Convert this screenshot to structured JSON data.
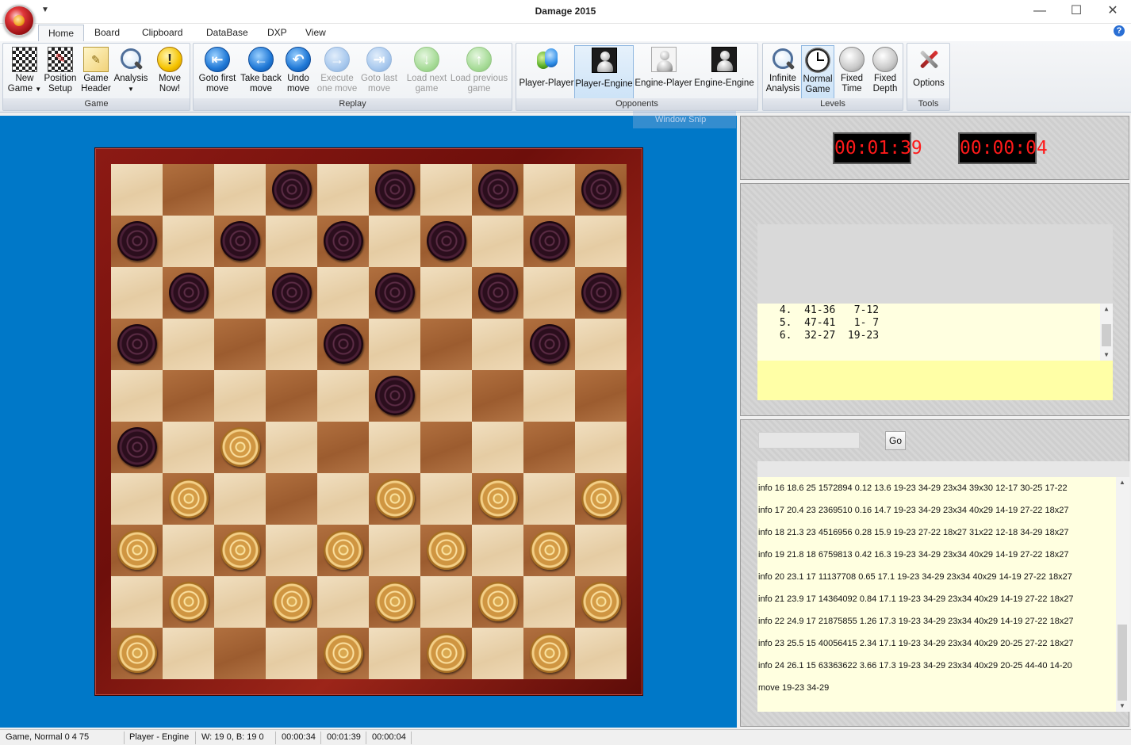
{
  "window": {
    "title": "Damage 2015",
    "minimize_glyph": "—",
    "maximize_glyph": "☐",
    "close_glyph": "✕"
  },
  "ribbon_tabs": [
    {
      "label": "Home",
      "active": true
    },
    {
      "label": "Board",
      "active": false
    },
    {
      "label": "Clipboard",
      "active": false
    },
    {
      "label": "DataBase",
      "active": false
    },
    {
      "label": "DXP",
      "active": false
    },
    {
      "label": "View",
      "active": false
    }
  ],
  "groups": {
    "game": {
      "caption": "Game",
      "new_game": {
        "line1": "New",
        "line2": "Game",
        "icon": "checkerboard-icon"
      },
      "position_setup": {
        "line1": "Position",
        "line2": "Setup",
        "icon": "checkerboard-pencil-icon"
      },
      "game_header": {
        "line1": "Game",
        "line2": "Header",
        "icon": "notepad-icon"
      },
      "analysis": {
        "line1": "Analysis",
        "line2": "",
        "icon": "magnifier-icon"
      },
      "move_now": {
        "line1": "Move",
        "line2": "Now!",
        "icon": "exclamation-icon"
      }
    },
    "replay": {
      "caption": "Replay",
      "goto_first": {
        "line1": "Goto first",
        "line2": "move",
        "icon": "goto-first-icon"
      },
      "take_back": {
        "line1": "Take back",
        "line2": "move",
        "icon": "arrow-left-icon"
      },
      "undo": {
        "line1": "Undo",
        "line2": "move",
        "icon": "undo-icon"
      },
      "execute": {
        "line1": "Execute",
        "line2": "one move",
        "icon": "arrow-right-icon"
      },
      "goto_last": {
        "line1": "Goto last",
        "line2": "move",
        "icon": "goto-last-icon"
      },
      "load_next": {
        "line1": "Load next",
        "line2": "game",
        "icon": "arrow-down-icon"
      },
      "load_previous": {
        "line1": "Load previous",
        "line2": "game",
        "icon": "arrow-up-icon"
      }
    },
    "opponents": {
      "caption": "Opponents",
      "player_player": "Player-Player",
      "player_engine": "Player-Engine",
      "engine_player": "Engine-Player",
      "engine_engine": "Engine-Engine"
    },
    "levels": {
      "caption": "Levels",
      "infinite": {
        "line1": "Infinite",
        "line2": "Analysis"
      },
      "normal": {
        "line1": "Normal",
        "line2": "Game"
      },
      "fixed_time": {
        "line1": "Fixed",
        "line2": "Time"
      },
      "fixed_depth": {
        "line1": "Fixed",
        "line2": "Depth"
      }
    },
    "tools": {
      "caption": "Tools",
      "options": "Options"
    }
  },
  "help_glyph": "?",
  "board": {
    "size": 10,
    "black": [
      [
        0,
        3
      ],
      [
        0,
        5
      ],
      [
        0,
        7
      ],
      [
        0,
        9
      ],
      [
        1,
        0
      ],
      [
        1,
        2
      ],
      [
        1,
        4
      ],
      [
        1,
        6
      ],
      [
        1,
        8
      ],
      [
        2,
        1
      ],
      [
        2,
        3
      ],
      [
        2,
        5
      ],
      [
        2,
        7
      ],
      [
        2,
        9
      ],
      [
        3,
        0
      ],
      [
        3,
        4
      ],
      [
        3,
        8
      ],
      [
        4,
        5
      ],
      [
        5,
        0
      ]
    ],
    "white": [
      [
        5,
        2
      ],
      [
        6,
        1
      ],
      [
        6,
        5
      ],
      [
        6,
        7
      ],
      [
        6,
        9
      ],
      [
        7,
        0
      ],
      [
        7,
        2
      ],
      [
        7,
        4
      ],
      [
        7,
        6
      ],
      [
        7,
        8
      ],
      [
        8,
        1
      ],
      [
        8,
        3
      ],
      [
        8,
        5
      ],
      [
        8,
        7
      ],
      [
        8,
        9
      ],
      [
        9,
        0
      ],
      [
        9,
        4
      ],
      [
        9,
        6
      ],
      [
        9,
        8
      ]
    ]
  },
  "window_snip": "Window Snip",
  "clocks": {
    "left": "00:01:39",
    "right": "00:00:04"
  },
  "notation": {
    "moves": [
      " 4.  41-36   7-12",
      " 5.  47-41   1- 7",
      " 6.  32-27  19-23"
    ]
  },
  "engine": {
    "go_label": "Go",
    "command_value": "",
    "output": [
      "info 16 18.6 25 1572894 0.12 13.6 19-23 34-29 23x34 39x30 12-17 30-25 17-22",
      "info 17 20.4 23 2369510 0.16 14.7 19-23 34-29 23x34 40x29 14-19 27-22 18x27",
      "info 18 21.3 23 4516956 0.28 15.9 19-23 27-22 18x27 31x22 12-18 34-29 18x27",
      "info 19 21.8 18 6759813 0.42 16.3 19-23 34-29 23x34 40x29 14-19 27-22 18x27",
      "info 20 23.1 17 11137708 0.65 17.1 19-23 34-29 23x34 40x29 14-19 27-22 18x27",
      "info 21 23.9 17 14364092 0.84 17.1 19-23 34-29 23x34 40x29 14-19 27-22 18x27",
      "info 22 24.9 17 21875855 1.26 17.3 19-23 34-29 23x34 40x29 14-19 27-22 18x27",
      "info 23 25.5 15 40056415 2.34 17.1 19-23 34-29 23x34 40x29 20-25 27-22 18x27",
      "info 24 26.1 15 63363622 3.66 17.3 19-23 34-29 23x34 40x29 20-25 44-40 14-20",
      "move 19-23 34-29"
    ]
  },
  "status": {
    "game_info": "Game, Normal 0 4 75",
    "mode": "Player - Engine",
    "counts": "W: 19  0, B: 19  0",
    "t1": "00:00:34",
    "t2": "00:01:39",
    "t3": "00:00:04"
  }
}
